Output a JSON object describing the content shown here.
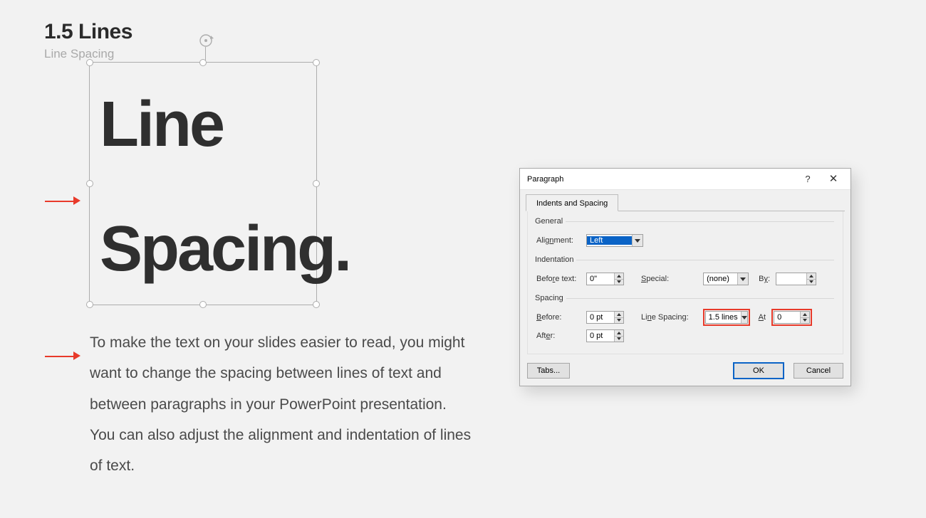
{
  "heading": "1.5 Lines",
  "subheading": "Line Spacing",
  "textbox": {
    "line1": "Line",
    "line2": "Spacing."
  },
  "description": "To make the text on your slides easier to read, you might want to change the spacing between lines of text and between paragraphs in your PowerPoint presentation. You can also adjust the alignment and indentation of lines of text.",
  "dialog": {
    "title": "Paragraph",
    "help": "?",
    "close": "✕",
    "tab": "Indents and Spacing",
    "groups": {
      "general": {
        "legend": "General",
        "alignment_label": "Alignment:",
        "alignment_value": "Left"
      },
      "indentation": {
        "legend": "Indentation",
        "before_text_label": "Before text:",
        "before_text_value": "0\"",
        "special_label": "Special:",
        "special_value": "(none)",
        "by_label": "By:",
        "by_value": ""
      },
      "spacing": {
        "legend": "Spacing",
        "before_label": "Before:",
        "before_value": "0 pt",
        "after_label": "After:",
        "after_value": "0 pt",
        "line_spacing_label": "Line Spacing:",
        "line_spacing_value": "1.5 lines",
        "at_label": "At",
        "at_value": "0"
      }
    },
    "buttons": {
      "tabs": "Tabs...",
      "ok": "OK",
      "cancel": "Cancel"
    }
  }
}
